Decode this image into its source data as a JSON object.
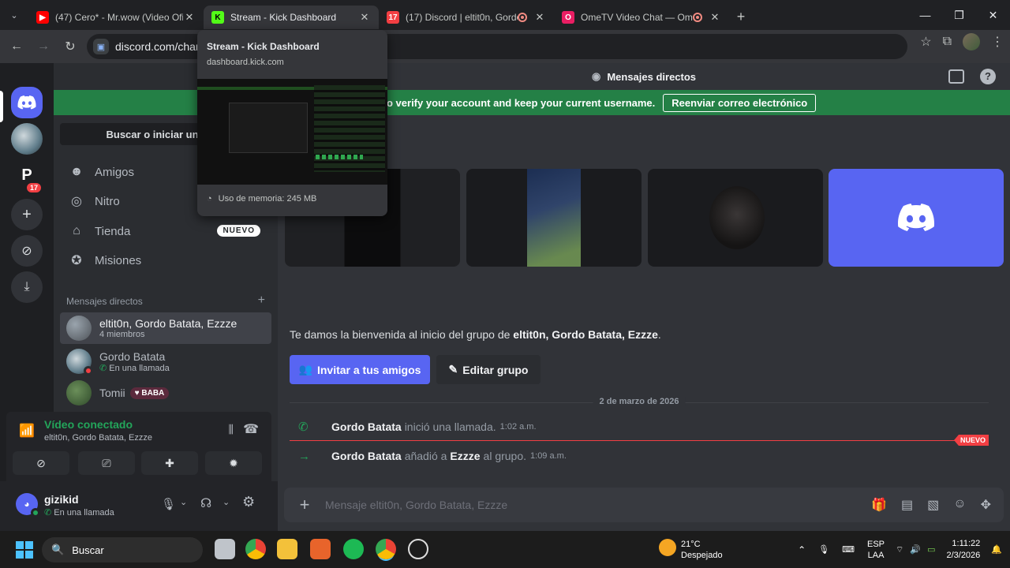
{
  "browser": {
    "tabs": [
      {
        "title": "(47) Cero* - Mr.wow (Video Ofi",
        "favicon": "youtube-icon",
        "color": "#ff0000"
      },
      {
        "title": "Stream - Kick Dashboard",
        "favicon": "kick-icon",
        "color": "#53fc18"
      },
      {
        "title": "(17) Discord | eltit0n, Gordo",
        "favicon": "discord-icon",
        "color": "#5865f2"
      },
      {
        "title": "OmeTV Video Chat — Ome",
        "favicon": "ometv-icon",
        "color": "#e91e63"
      }
    ],
    "address": "discord.com/chan",
    "popup": {
      "title": "Stream - Kick Dashboard",
      "url": "dashboard.kick.com",
      "memory": "Uso de memoria: 245 MB"
    }
  },
  "discord": {
    "topbar_title": "Mensajes directos",
    "notice_text": "o verify your account and keep your current username.",
    "notice_button": "Reenviar correo electrónico",
    "search_placeholder": "Buscar o iniciar una con",
    "rail_badge": "17",
    "nav": [
      {
        "label": "Amigos",
        "icon": "friends-icon"
      },
      {
        "label": "Nitro",
        "icon": "nitro-icon"
      },
      {
        "label": "Tienda",
        "icon": "shop-icon",
        "badge": "NUEVO"
      },
      {
        "label": "Misiones",
        "icon": "quests-icon"
      }
    ],
    "dm_header": "Mensajes directos",
    "dms": [
      {
        "name": "eltit0n, Gordo Batata, Ezzze",
        "sub": "4 miembros"
      },
      {
        "name": "Gordo Batata",
        "sub": "En una llamada"
      },
      {
        "name": "Tomii",
        "sub": "BABA"
      }
    ],
    "voice": {
      "title": "Vídeo conectado",
      "sub": "eltit0n, Gordo Batata, Ezzze"
    },
    "user": {
      "name": "gizikid",
      "status": "En una llamada"
    },
    "welcome_prefix": "Te damos la bienvenida al inicio del grupo de ",
    "welcome_group": "eltit0n, Gordo Batata, Ezzze",
    "welcome_suffix": ".",
    "invite_button": "Invitar a tus amigos",
    "edit_button": "Editar grupo",
    "date_separator": "2 de marzo de 2026",
    "messages": [
      {
        "actor": "Gordo Batata",
        "text": "inició una llamada.",
        "time": "1:02 a.m.",
        "target": ""
      },
      {
        "actor": "Gordo Batata",
        "text": "añadió a",
        "target": "Ezzze",
        "text2": "al grupo.",
        "time": "1:09 a.m."
      }
    ],
    "new_tag": "NUEVO",
    "composer_placeholder": "Mensaje eltit0n, Gordo Batata, Ezzze"
  },
  "taskbar": {
    "search": "Buscar",
    "weather_temp": "21°C",
    "weather_desc": "Despejado",
    "lang": "ESP",
    "lang2": "LAA",
    "time": "1:11:22",
    "date": "2/3/2026"
  }
}
